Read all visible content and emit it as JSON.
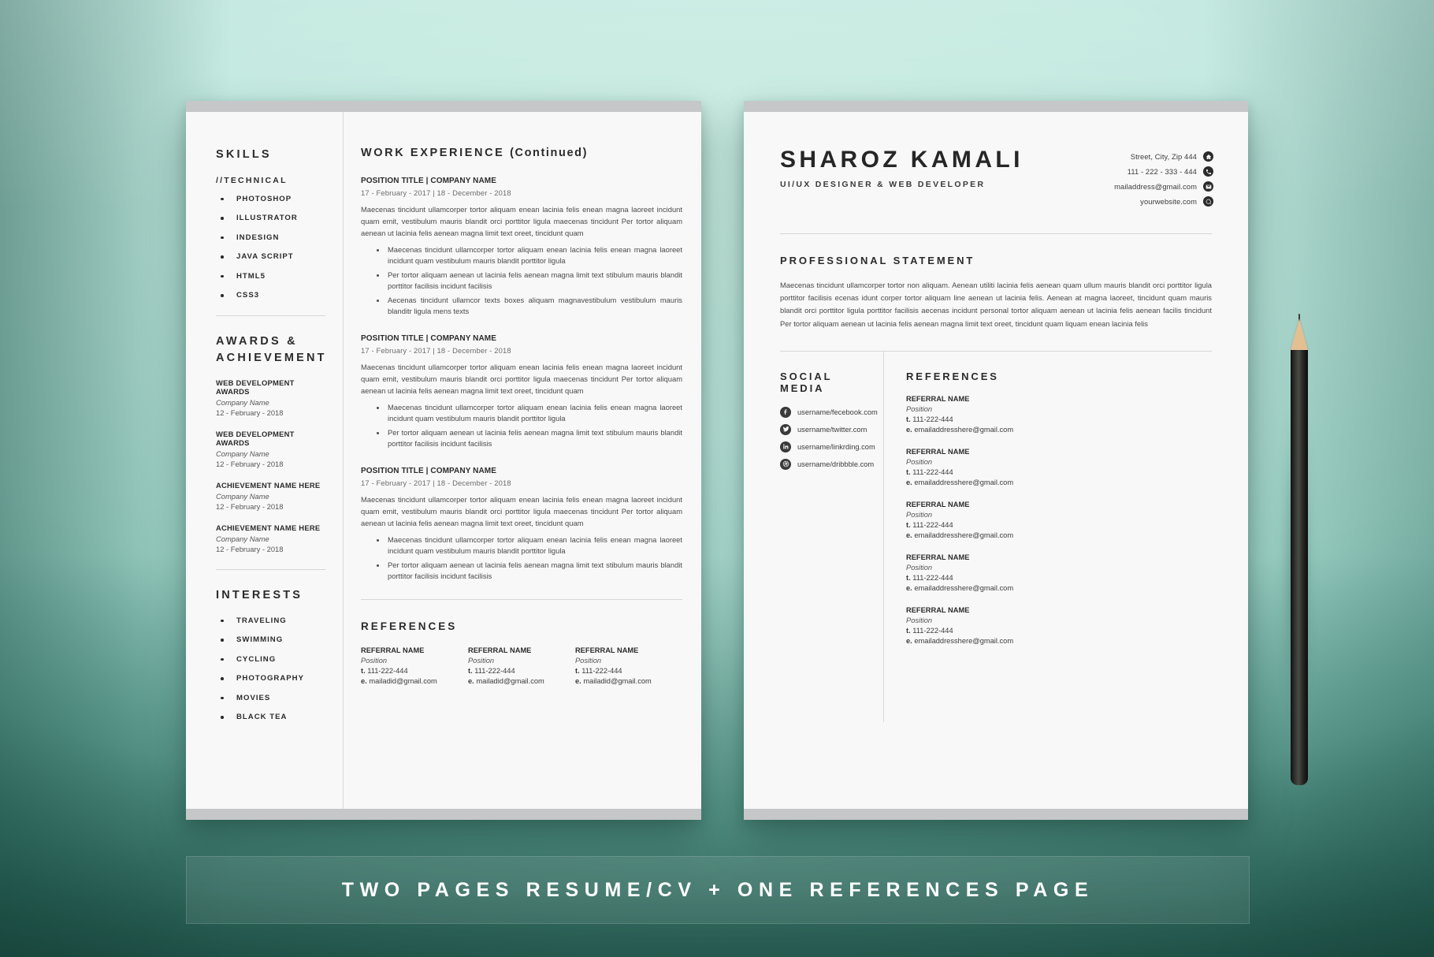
{
  "banner": {
    "text": "TWO PAGES RESUME/CV + ONE REFERENCES PAGE"
  },
  "colors": {
    "background_mint": "#bfe8de",
    "background_deep": "#255a50",
    "page": "#f8f8f8",
    "page_bar": "#c6c7c9",
    "text_dark": "#2b2b2b",
    "text_body": "#4a4a4a",
    "banner_text": "#ffffff"
  },
  "page1": {
    "sidebar": {
      "skills": {
        "title": "SKILLS",
        "sub_label": "//TECHNICAL",
        "items": [
          "PHOTOSHOP",
          "ILLUSTRATOR",
          "INDESIGN",
          "JAVA SCRIPT",
          "HTML5",
          "CSS3"
        ]
      },
      "awards": {
        "title_line1": "AWARDS &",
        "title_line2": "ACHIEVEMENT",
        "items": [
          {
            "name": "WEB DEVELOPMENT AWARDS",
            "company": "Company Name",
            "date": "12 - February - 2018"
          },
          {
            "name": "WEB DEVELOPMENT AWARDS",
            "company": "Company Name",
            "date": "12 - February - 2018"
          },
          {
            "name": "ACHIEVEMENT NAME HERE",
            "company": "Company Name",
            "date": "12 - February - 2018"
          },
          {
            "name": "ACHIEVEMENT NAME HERE",
            "company": "Company Name",
            "date": "12 - February - 2018"
          }
        ]
      },
      "interests": {
        "title": "INTERESTS",
        "items": [
          "TRAVELING",
          "SWIMMING",
          "CYCLING",
          "PHOTOGRAPHY",
          "MOVIES",
          "BLACK TEA"
        ]
      }
    },
    "work": {
      "title_main": "WORK EXPERIENCE",
      "title_suffix": "(Continued)",
      "jobs": [
        {
          "title": "POSITION TITLE | COMPANY NAME",
          "date": "17 - February - 2017 | 18 - December - 2018",
          "desc": "Maecenas tincidunt ullamcorper tortor aliquam enean lacinia felis enean magna laoreet incidunt quam emit, vestibulum mauris blandit orci porttitor ligula maecenas tincidunt Per tortor aliquam aenean ut lacinia felis aenean magna limit text oreet, tincidunt quam",
          "points": [
            "Maecenas tincidunt ullamcorper tortor aliquam enean lacinia felis enean magna laoreet incidunt quam  vestibulum mauris blandit porttitor ligula",
            "Per tortor aliquam aenean ut lacinia felis aenean magna limit text stibulum mauris blandit porttitor facilisis incidunt facilisis",
            "Aecenas tincidunt ullamcor texts boxes aliquam magnavestibulum vestibulum mauris blanditr ligula mens texts"
          ]
        },
        {
          "title": "POSITION TITLE | COMPANY NAME",
          "date": "17 - February - 2017 | 18 - December - 2018",
          "desc": "Maecenas tincidunt ullamcorper tortor aliquam enean lacinia felis enean magna laoreet incidunt quam emit, vestibulum mauris blandit orci porttitor ligula maecenas tincidunt Per tortor aliquam aenean ut lacinia felis aenean magna limit text oreet, tincidunt quam",
          "points": [
            "Maecenas tincidunt ullamcorper tortor aliquam enean lacinia felis enean magna laoreet incidunt quam  vestibulum mauris blandit porttitor ligula",
            "Per tortor aliquam aenean ut lacinia felis aenean magna limit text stibulum mauris blandit porttitor facilisis incidunt facilisis"
          ]
        },
        {
          "title": "POSITION TITLE | COMPANY NAME",
          "date": "17 - February - 2017 | 18 - December - 2018",
          "desc": "Maecenas tincidunt ullamcorper tortor aliquam enean lacinia felis enean magna laoreet incidunt quam emit, vestibulum mauris blandit orci porttitor ligula maecenas tincidunt Per tortor aliquam aenean ut lacinia felis aenean magna limit text oreet, tincidunt quam",
          "points": [
            "Maecenas tincidunt ullamcorper tortor aliquam enean lacinia felis enean magna laoreet incidunt quam  vestibulum mauris blandit porttitor ligula",
            "Per tortor aliquam aenean ut lacinia felis aenean magna limit text stibulum mauris blandit porttitor facilisis incidunt facilisis"
          ]
        }
      ]
    },
    "references": {
      "title": "REFERENCES",
      "items": [
        {
          "name": "REFERRAL NAME",
          "position": "Position",
          "phone_label": "t.",
          "phone": "111-222-444",
          "email_label": "e.",
          "email": "mailadid@gmail.com"
        },
        {
          "name": "REFERRAL NAME",
          "position": "Position",
          "phone_label": "t.",
          "phone": "111-222-444",
          "email_label": "e.",
          "email": "mailadid@gmail.com"
        },
        {
          "name": "REFERRAL NAME",
          "position": "Position",
          "phone_label": "t.",
          "phone": "111-222-444",
          "email_label": "e.",
          "email": "mailadid@gmail.com"
        }
      ]
    }
  },
  "page2": {
    "name": "SHAROZ KAMALI",
    "role": "UI/UX DESIGNER & WEB DEVELOPER",
    "contacts": [
      {
        "icon": "home-icon",
        "text": "Street, City, Zip 444"
      },
      {
        "icon": "phone-icon",
        "text": "111 - 222 - 333 - 444"
      },
      {
        "icon": "envelope-icon",
        "text": "mailaddress@gmail.com"
      },
      {
        "icon": "globe-icon",
        "text": "yourwebsite.com"
      }
    ],
    "statement": {
      "title": "PROFESSIONAL STATEMENT",
      "text": "Maecenas tincidunt ullamcorper tortor non aliquam. Aenean utiliti lacinia felis aenean quam ullum mauris blandit orci porttitor ligula porttitor facilisis ecenas idunt corper tortor aliquam line aenean ut lacinia felis. Aenean at magna laoreet, tincidunt quam mauris blandit orci porttitor ligula porttitor facilisis aecenas incidunt personal tortor aliquam aenean ut lacinia felis aenean facilis tincidunt Per tortor aliquam aenean ut lacinia felis aenean magna limit text oreet, tincidunt quam liquam enean lacinia felis"
    },
    "social": {
      "title": "SOCIAL MEDIA",
      "items": [
        {
          "icon": "facebook-icon",
          "text": "username/fecebook.com"
        },
        {
          "icon": "twitter-icon",
          "text": "username/twitter.com"
        },
        {
          "icon": "linkedin-icon",
          "text": "username/linkrding.com"
        },
        {
          "icon": "dribbble-icon",
          "text": "username/dribbble.com"
        }
      ]
    },
    "references": {
      "title": "REFERENCES",
      "items": [
        {
          "name": "REFERRAL NAME",
          "position": "Position",
          "phone_label": "t.",
          "phone": "111-222-444",
          "email_label": "e.",
          "email": "emailaddresshere@gmail.com"
        },
        {
          "name": "REFERRAL NAME",
          "position": "Position",
          "phone_label": "t.",
          "phone": "111-222-444",
          "email_label": "e.",
          "email": "emailaddresshere@gmail.com"
        },
        {
          "name": "REFERRAL NAME",
          "position": "Position",
          "phone_label": "t.",
          "phone": "111-222-444",
          "email_label": "e.",
          "email": "emailaddresshere@gmail.com"
        },
        {
          "name": "REFERRAL NAME",
          "position": "Position",
          "phone_label": "t.",
          "phone": "111-222-444",
          "email_label": "e.",
          "email": "emailaddresshere@gmail.com"
        },
        {
          "name": "REFERRAL NAME",
          "position": "Position",
          "phone_label": "t.",
          "phone": "111-222-444",
          "email_label": "e.",
          "email": "emailaddresshere@gmail.com"
        }
      ]
    }
  }
}
